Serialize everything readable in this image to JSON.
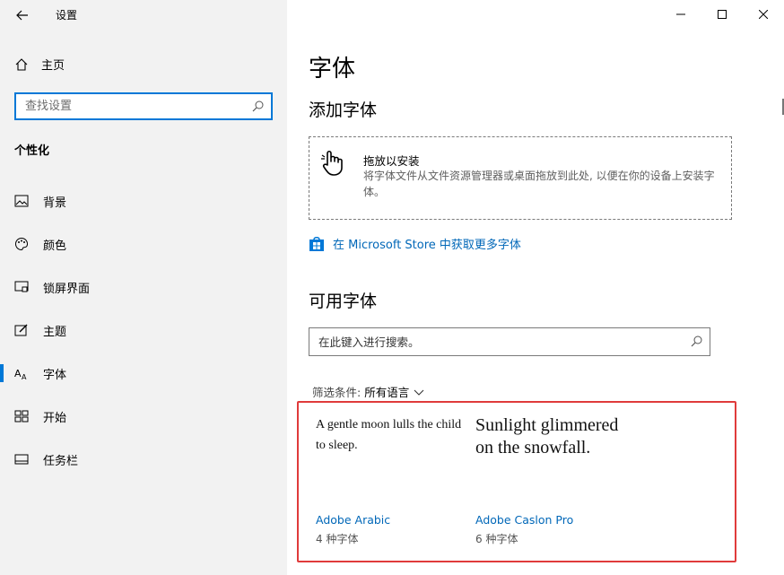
{
  "window": {
    "title": "设置",
    "controls": [
      "minimize",
      "maximize",
      "close"
    ]
  },
  "sidebar": {
    "home_label": "主页",
    "search_placeholder": "查找设置",
    "section_title": "个性化",
    "items": [
      {
        "label": "背景",
        "icon": "image-icon"
      },
      {
        "label": "颜色",
        "icon": "palette-icon"
      },
      {
        "label": "锁屏界面",
        "icon": "lockscreen-icon"
      },
      {
        "label": "主题",
        "icon": "theme-icon"
      },
      {
        "label": "字体",
        "icon": "font-icon",
        "active": true
      },
      {
        "label": "开始",
        "icon": "start-icon"
      },
      {
        "label": "任务栏",
        "icon": "taskbar-icon"
      }
    ]
  },
  "main": {
    "title": "字体",
    "add_fonts_heading": "添加字体",
    "dropzone": {
      "title": "拖放以安装",
      "description": "将字体文件从文件资源管理器或桌面拖放到此处, 以便在你的设备上安装字体。"
    },
    "store_link": "在 Microsoft Store 中获取更多字体",
    "available_heading": "可用字体",
    "font_search_placeholder": "在此键入进行搜索。",
    "filter_label": "筛选条件:",
    "filter_value": "所有语言",
    "fonts": [
      {
        "sample": "A gentle moon lulls the child to sleep.",
        "name": "Adobe Arabic",
        "count": "4 种字体"
      },
      {
        "sample": "Sunlight glimmered on the snowfall.",
        "name": "Adobe Caslon Pro",
        "count": "6 种字体"
      }
    ]
  },
  "colors": {
    "accent": "#0078d7",
    "link": "#0067b8",
    "highlight_border": "#e03b3b",
    "sidebar_bg": "#f2f2f2"
  }
}
